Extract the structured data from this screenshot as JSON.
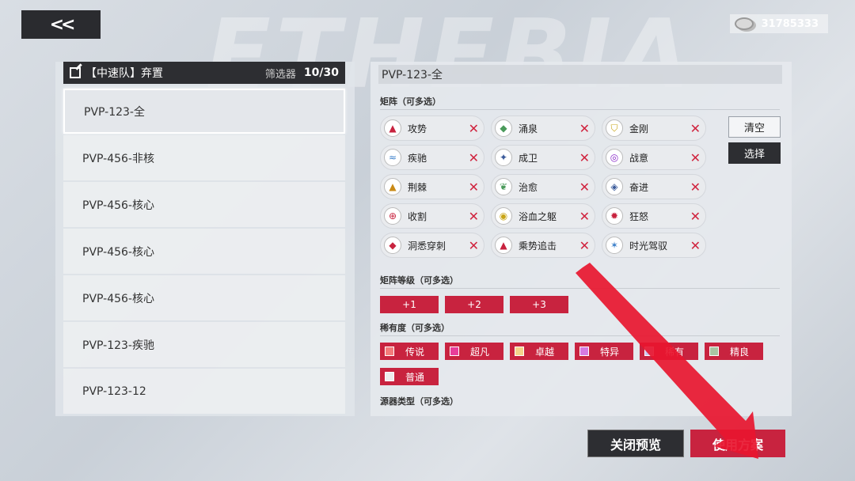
{
  "currency": {
    "icon": "coin-icon",
    "amount": "31785333"
  },
  "left": {
    "title": "【中速队】弃置",
    "filter_label": "筛选器",
    "count": "10/30",
    "plans": [
      "PVP-123-全",
      "PVP-456-非核",
      "PVP-456-核心",
      "PVP-456-核心",
      "PVP-456-核心",
      "PVP-123-疾驰",
      "PVP-123-12"
    ],
    "selected_index": 0
  },
  "right": {
    "title": "PVP-123-全",
    "matrix_label": "矩阵（可多选）",
    "clear_label": "清空",
    "select_label": "选择",
    "matrix": [
      {
        "label": "攻势",
        "icon": "attack-icon"
      },
      {
        "label": "涌泉",
        "icon": "spring-icon"
      },
      {
        "label": "金刚",
        "icon": "diamond-shield-icon"
      },
      {
        "label": "疾驰",
        "icon": "gallop-icon"
      },
      {
        "label": "成卫",
        "icon": "guard-icon"
      },
      {
        "label": "战意",
        "icon": "fighting-spirit-icon"
      },
      {
        "label": "荆棘",
        "icon": "thorns-icon"
      },
      {
        "label": "治愈",
        "icon": "heal-icon"
      },
      {
        "label": "奋进",
        "icon": "advance-icon"
      },
      {
        "label": "收割",
        "icon": "harvest-icon"
      },
      {
        "label": "浴血之躯",
        "icon": "bloodbath-icon"
      },
      {
        "label": "狂怒",
        "icon": "rage-icon"
      },
      {
        "label": "洞悉穿刺",
        "icon": "pierce-icon"
      },
      {
        "label": "乘势追击",
        "icon": "pursuit-icon"
      },
      {
        "label": "时光驾驭",
        "icon": "time-icon"
      }
    ],
    "remove_glyph": "✕",
    "level_label": "矩阵等级（可多选）",
    "levels": [
      "+1",
      "+2",
      "+3"
    ],
    "rarity_label": "稀有度（可多选）",
    "rarities": [
      {
        "label": "传说",
        "color": "#f47a7a"
      },
      {
        "label": "超凡",
        "color": "#e83e9a"
      },
      {
        "label": "卓越",
        "color": "#f5d38a"
      },
      {
        "label": "特异",
        "color": "#d67ae0"
      },
      {
        "label": "稀有",
        "color": "#c9c5f2"
      },
      {
        "label": "精良",
        "color": "#a9c4a3"
      },
      {
        "label": "普通",
        "color": "#eeeeee"
      }
    ],
    "source_label": "源器类型（可多选）"
  },
  "buttons": {
    "close_preview": "关闭预览",
    "use_plan": "使用方案"
  },
  "accent_color": "#c8233f"
}
